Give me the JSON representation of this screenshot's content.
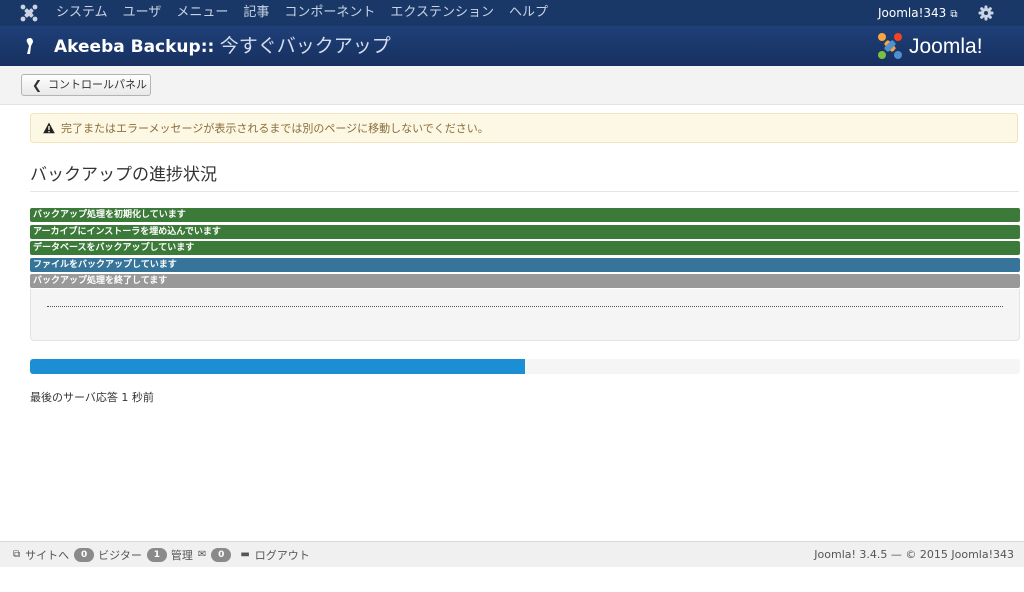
{
  "topnav": {
    "menu": [
      "システム",
      "ユーザ",
      "メニュー",
      "記事",
      "コンポーネント",
      "エクステンション",
      "ヘルプ"
    ],
    "site_name": "Joomla!343"
  },
  "header": {
    "title_bold": "Akeeba Backup::",
    "title_normal": "今すぐバックアップ",
    "brand": "Joomla!"
  },
  "toolbar": {
    "back_label": "コントロールパネル"
  },
  "alert": {
    "message": "完了またはエラーメッセージが表示されるまでは別のページに移動しないでください。"
  },
  "main": {
    "title": "バックアップの進捗状況",
    "steps": [
      {
        "label": "バックアップ処理を初期化しています",
        "state": "done"
      },
      {
        "label": "アーカイブにインストーラを埋め込んでいます",
        "state": "done"
      },
      {
        "label": "データベースをバックアップしています",
        "state": "done"
      },
      {
        "label": "ファイルをバックアップしています",
        "state": "active"
      },
      {
        "label": "バックアップ処理を終了してます",
        "state": "pending"
      }
    ],
    "progress_percent": 50,
    "last_response": "最後のサーバ応答 1 秒前"
  },
  "colors": {
    "topnav": "#1a3867",
    "header": "#1f4079",
    "step_done": "#3c7a3a",
    "step_active": "#367599",
    "step_pending": "#999999",
    "progress": "#1c8fd4"
  },
  "status": {
    "view_site": "サイトへ",
    "visitors_count": "0",
    "visitors_label": "ビジター",
    "admins_count": "1",
    "admins_label": "管理",
    "messages_count": "0",
    "logout": "ログアウト",
    "footer": "Joomla! 3.4.5 — © 2015 Joomla!343"
  }
}
